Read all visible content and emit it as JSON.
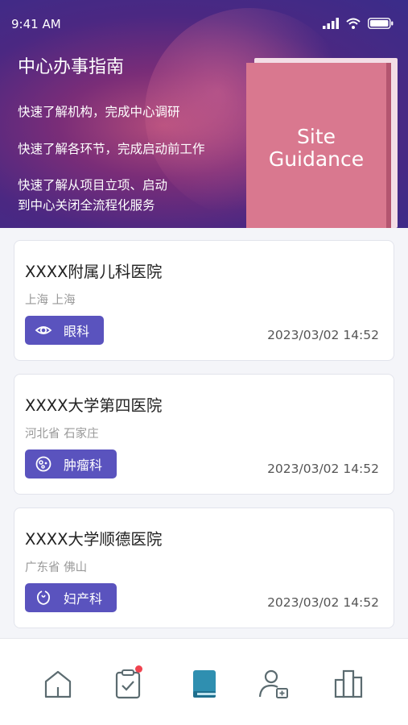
{
  "status_bar": {
    "time": "9:41 AM"
  },
  "hero": {
    "title": "中心办事指南",
    "lines": [
      "快速了解机构，完成中心调研",
      "快速了解各环节，完成启动前工作",
      "快速了解从项目立项、启动",
      "到中心关闭全流程化服务"
    ],
    "book_text_line1": "Site",
    "book_text_line2": "Guidance"
  },
  "cards": [
    {
      "title": "XXXX附属儿科医院",
      "location": "上海 上海",
      "department": "眼科",
      "department_icon": "eye-icon",
      "time": "2023/03/02 14:52"
    },
    {
      "title": "XXXX大学第四医院",
      "location": "河北省 石家庄",
      "department": "肿瘤科",
      "department_icon": "cell-icon",
      "time": "2023/03/02 14:52"
    },
    {
      "title": "XXXX大学顺德医院",
      "location": "广东省 佛山",
      "department": "妇产科",
      "department_icon": "womb-icon",
      "time": "2023/03/02 14:52"
    }
  ],
  "tab_bar": {
    "tabs": [
      {
        "icon": "home-icon",
        "active": false
      },
      {
        "icon": "clipboard-check-icon",
        "active": false,
        "badge": true
      },
      {
        "icon": "book-icon",
        "active": true
      },
      {
        "icon": "user-plus-icon",
        "active": false
      },
      {
        "icon": "bar-chart-icon",
        "active": false
      }
    ]
  },
  "colors": {
    "accent": "#5a53be",
    "active_tab": "#2f8fb0",
    "inactive_tab": "#5b6b70",
    "badge": "#f0434f",
    "book_cover": "#d9788f"
  }
}
